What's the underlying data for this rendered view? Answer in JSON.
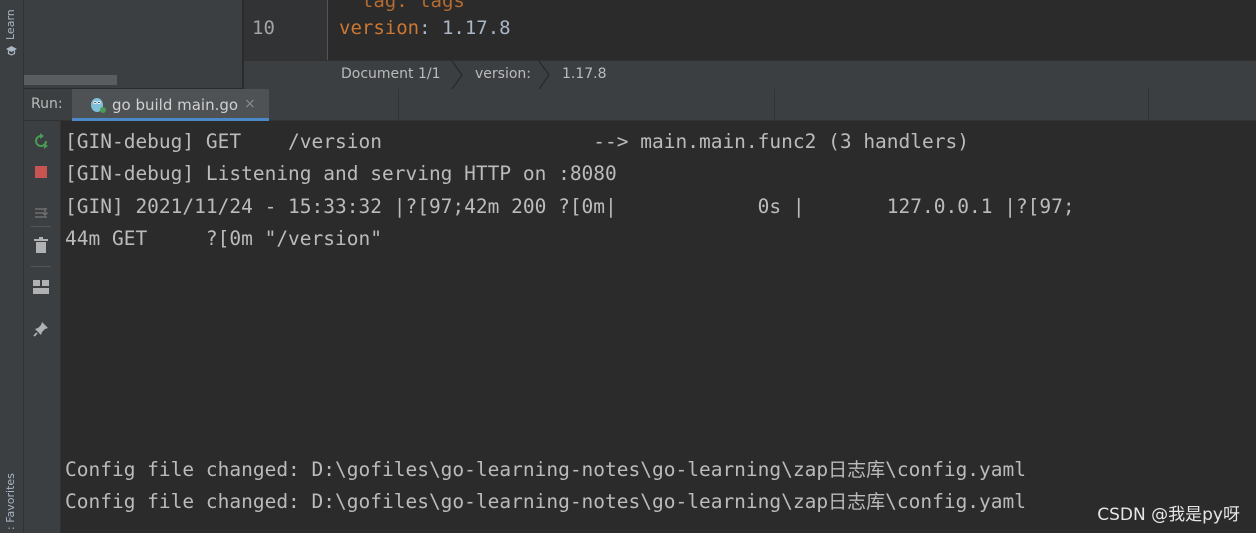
{
  "left_stripe": {
    "learn_label": "Learn",
    "favorites_label": ": Favorites"
  },
  "editor": {
    "prev_line_text": "  tag: tags",
    "line_number": "10",
    "code_key": "version",
    "code_colon": ":",
    "code_value": " 1.17.8"
  },
  "breadcrumb": {
    "items": [
      "Document 1/1",
      "version:",
      "1.17.8"
    ]
  },
  "run_panel": {
    "label": "Run:",
    "tab_label": "go build main.go",
    "tab_close": "×"
  },
  "run_toolbar": {
    "buttons": [
      "rerun-icon",
      "stop-icon",
      "scroll-to-end-icon",
      "clear-icon",
      "layout-icon",
      "pin-icon"
    ]
  },
  "console": {
    "lines": [
      "[GIN-debug] GET    /version                  --> main.main.func2 (3 handlers)",
      "[GIN-debug] Listening and serving HTTP on :8080",
      "[GIN] 2021/11/24 - 15:33:32 |?[97;42m 200 ?[0m|            0s |       127.0.0.1 |?[97;",
      "44m GET     ?[0m \"/version\""
    ],
    "config_lines": [
      {
        "prefix": "Config file changed: D:\\gofiles\\go-learning-notes\\go-learning\\zap",
        "cjk": "日志库",
        "suffix": "\\config.yaml"
      },
      {
        "prefix": "Config file changed: D:\\gofiles\\go-learning-notes\\go-learning\\zap",
        "cjk": "日志库",
        "suffix": "\\config.yaml"
      }
    ]
  },
  "watermark": "CSDN @我是py呀",
  "colors": {
    "accent": "#4a88c7",
    "rerun": "#499c54",
    "stop": "#c75450",
    "yaml_key": "#cc7832"
  }
}
